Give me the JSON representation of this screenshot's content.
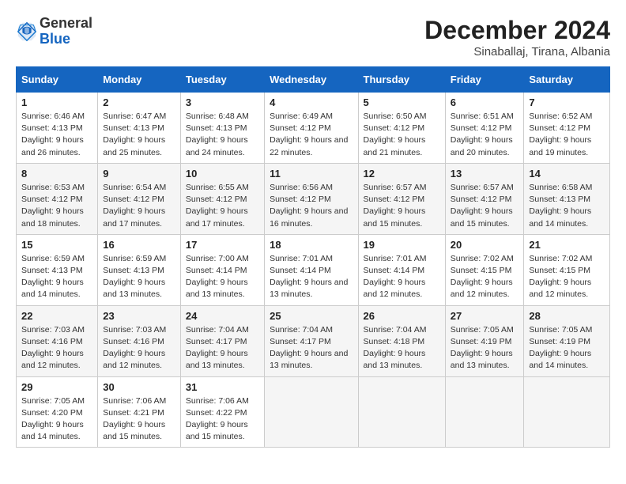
{
  "header": {
    "logo_general": "General",
    "logo_blue": "Blue",
    "month_year": "December 2024",
    "location": "Sinaballaj, Tirana, Albania"
  },
  "days_of_week": [
    "Sunday",
    "Monday",
    "Tuesday",
    "Wednesday",
    "Thursday",
    "Friday",
    "Saturday"
  ],
  "weeks": [
    [
      {
        "day": 1,
        "info": "Sunrise: 6:46 AM\nSunset: 4:13 PM\nDaylight: 9 hours and 26 minutes."
      },
      {
        "day": 2,
        "info": "Sunrise: 6:47 AM\nSunset: 4:13 PM\nDaylight: 9 hours and 25 minutes."
      },
      {
        "day": 3,
        "info": "Sunrise: 6:48 AM\nSunset: 4:13 PM\nDaylight: 9 hours and 24 minutes."
      },
      {
        "day": 4,
        "info": "Sunrise: 6:49 AM\nSunset: 4:12 PM\nDaylight: 9 hours and 22 minutes."
      },
      {
        "day": 5,
        "info": "Sunrise: 6:50 AM\nSunset: 4:12 PM\nDaylight: 9 hours and 21 minutes."
      },
      {
        "day": 6,
        "info": "Sunrise: 6:51 AM\nSunset: 4:12 PM\nDaylight: 9 hours and 20 minutes."
      },
      {
        "day": 7,
        "info": "Sunrise: 6:52 AM\nSunset: 4:12 PM\nDaylight: 9 hours and 19 minutes."
      }
    ],
    [
      {
        "day": 8,
        "info": "Sunrise: 6:53 AM\nSunset: 4:12 PM\nDaylight: 9 hours and 18 minutes."
      },
      {
        "day": 9,
        "info": "Sunrise: 6:54 AM\nSunset: 4:12 PM\nDaylight: 9 hours and 17 minutes."
      },
      {
        "day": 10,
        "info": "Sunrise: 6:55 AM\nSunset: 4:12 PM\nDaylight: 9 hours and 17 minutes."
      },
      {
        "day": 11,
        "info": "Sunrise: 6:56 AM\nSunset: 4:12 PM\nDaylight: 9 hours and 16 minutes."
      },
      {
        "day": 12,
        "info": "Sunrise: 6:57 AM\nSunset: 4:12 PM\nDaylight: 9 hours and 15 minutes."
      },
      {
        "day": 13,
        "info": "Sunrise: 6:57 AM\nSunset: 4:12 PM\nDaylight: 9 hours and 15 minutes."
      },
      {
        "day": 14,
        "info": "Sunrise: 6:58 AM\nSunset: 4:13 PM\nDaylight: 9 hours and 14 minutes."
      }
    ],
    [
      {
        "day": 15,
        "info": "Sunrise: 6:59 AM\nSunset: 4:13 PM\nDaylight: 9 hours and 14 minutes."
      },
      {
        "day": 16,
        "info": "Sunrise: 6:59 AM\nSunset: 4:13 PM\nDaylight: 9 hours and 13 minutes."
      },
      {
        "day": 17,
        "info": "Sunrise: 7:00 AM\nSunset: 4:14 PM\nDaylight: 9 hours and 13 minutes."
      },
      {
        "day": 18,
        "info": "Sunrise: 7:01 AM\nSunset: 4:14 PM\nDaylight: 9 hours and 13 minutes."
      },
      {
        "day": 19,
        "info": "Sunrise: 7:01 AM\nSunset: 4:14 PM\nDaylight: 9 hours and 12 minutes."
      },
      {
        "day": 20,
        "info": "Sunrise: 7:02 AM\nSunset: 4:15 PM\nDaylight: 9 hours and 12 minutes."
      },
      {
        "day": 21,
        "info": "Sunrise: 7:02 AM\nSunset: 4:15 PM\nDaylight: 9 hours and 12 minutes."
      }
    ],
    [
      {
        "day": 22,
        "info": "Sunrise: 7:03 AM\nSunset: 4:16 PM\nDaylight: 9 hours and 12 minutes."
      },
      {
        "day": 23,
        "info": "Sunrise: 7:03 AM\nSunset: 4:16 PM\nDaylight: 9 hours and 12 minutes."
      },
      {
        "day": 24,
        "info": "Sunrise: 7:04 AM\nSunset: 4:17 PM\nDaylight: 9 hours and 13 minutes."
      },
      {
        "day": 25,
        "info": "Sunrise: 7:04 AM\nSunset: 4:17 PM\nDaylight: 9 hours and 13 minutes."
      },
      {
        "day": 26,
        "info": "Sunrise: 7:04 AM\nSunset: 4:18 PM\nDaylight: 9 hours and 13 minutes."
      },
      {
        "day": 27,
        "info": "Sunrise: 7:05 AM\nSunset: 4:19 PM\nDaylight: 9 hours and 13 minutes."
      },
      {
        "day": 28,
        "info": "Sunrise: 7:05 AM\nSunset: 4:19 PM\nDaylight: 9 hours and 14 minutes."
      }
    ],
    [
      {
        "day": 29,
        "info": "Sunrise: 7:05 AM\nSunset: 4:20 PM\nDaylight: 9 hours and 14 minutes."
      },
      {
        "day": 30,
        "info": "Sunrise: 7:06 AM\nSunset: 4:21 PM\nDaylight: 9 hours and 15 minutes."
      },
      {
        "day": 31,
        "info": "Sunrise: 7:06 AM\nSunset: 4:22 PM\nDaylight: 9 hours and 15 minutes."
      },
      null,
      null,
      null,
      null
    ]
  ]
}
